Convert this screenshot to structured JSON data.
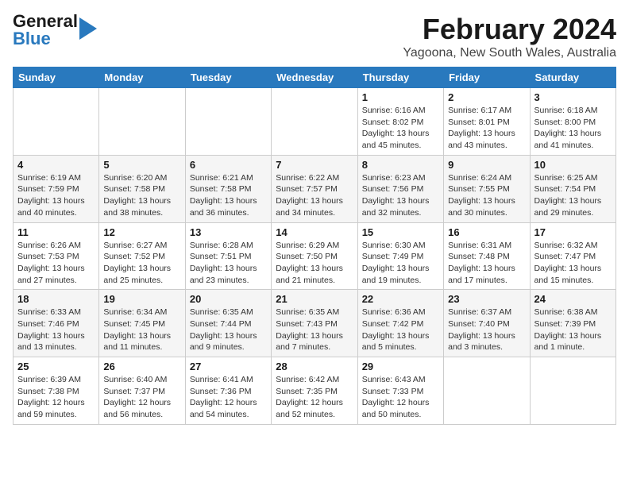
{
  "header": {
    "logo_general": "General",
    "logo_blue": "Blue",
    "month_title": "February 2024",
    "location": "Yagoona, New South Wales, Australia"
  },
  "days_of_week": [
    "Sunday",
    "Monday",
    "Tuesday",
    "Wednesday",
    "Thursday",
    "Friday",
    "Saturday"
  ],
  "weeks": [
    [
      {
        "day": "",
        "info": ""
      },
      {
        "day": "",
        "info": ""
      },
      {
        "day": "",
        "info": ""
      },
      {
        "day": "",
        "info": ""
      },
      {
        "day": "1",
        "info": "Sunrise: 6:16 AM\nSunset: 8:02 PM\nDaylight: 13 hours\nand 45 minutes."
      },
      {
        "day": "2",
        "info": "Sunrise: 6:17 AM\nSunset: 8:01 PM\nDaylight: 13 hours\nand 43 minutes."
      },
      {
        "day": "3",
        "info": "Sunrise: 6:18 AM\nSunset: 8:00 PM\nDaylight: 13 hours\nand 41 minutes."
      }
    ],
    [
      {
        "day": "4",
        "info": "Sunrise: 6:19 AM\nSunset: 7:59 PM\nDaylight: 13 hours\nand 40 minutes."
      },
      {
        "day": "5",
        "info": "Sunrise: 6:20 AM\nSunset: 7:58 PM\nDaylight: 13 hours\nand 38 minutes."
      },
      {
        "day": "6",
        "info": "Sunrise: 6:21 AM\nSunset: 7:58 PM\nDaylight: 13 hours\nand 36 minutes."
      },
      {
        "day": "7",
        "info": "Sunrise: 6:22 AM\nSunset: 7:57 PM\nDaylight: 13 hours\nand 34 minutes."
      },
      {
        "day": "8",
        "info": "Sunrise: 6:23 AM\nSunset: 7:56 PM\nDaylight: 13 hours\nand 32 minutes."
      },
      {
        "day": "9",
        "info": "Sunrise: 6:24 AM\nSunset: 7:55 PM\nDaylight: 13 hours\nand 30 minutes."
      },
      {
        "day": "10",
        "info": "Sunrise: 6:25 AM\nSunset: 7:54 PM\nDaylight: 13 hours\nand 29 minutes."
      }
    ],
    [
      {
        "day": "11",
        "info": "Sunrise: 6:26 AM\nSunset: 7:53 PM\nDaylight: 13 hours\nand 27 minutes."
      },
      {
        "day": "12",
        "info": "Sunrise: 6:27 AM\nSunset: 7:52 PM\nDaylight: 13 hours\nand 25 minutes."
      },
      {
        "day": "13",
        "info": "Sunrise: 6:28 AM\nSunset: 7:51 PM\nDaylight: 13 hours\nand 23 minutes."
      },
      {
        "day": "14",
        "info": "Sunrise: 6:29 AM\nSunset: 7:50 PM\nDaylight: 13 hours\nand 21 minutes."
      },
      {
        "day": "15",
        "info": "Sunrise: 6:30 AM\nSunset: 7:49 PM\nDaylight: 13 hours\nand 19 minutes."
      },
      {
        "day": "16",
        "info": "Sunrise: 6:31 AM\nSunset: 7:48 PM\nDaylight: 13 hours\nand 17 minutes."
      },
      {
        "day": "17",
        "info": "Sunrise: 6:32 AM\nSunset: 7:47 PM\nDaylight: 13 hours\nand 15 minutes."
      }
    ],
    [
      {
        "day": "18",
        "info": "Sunrise: 6:33 AM\nSunset: 7:46 PM\nDaylight: 13 hours\nand 13 minutes."
      },
      {
        "day": "19",
        "info": "Sunrise: 6:34 AM\nSunset: 7:45 PM\nDaylight: 13 hours\nand 11 minutes."
      },
      {
        "day": "20",
        "info": "Sunrise: 6:35 AM\nSunset: 7:44 PM\nDaylight: 13 hours\nand 9 minutes."
      },
      {
        "day": "21",
        "info": "Sunrise: 6:35 AM\nSunset: 7:43 PM\nDaylight: 13 hours\nand 7 minutes."
      },
      {
        "day": "22",
        "info": "Sunrise: 6:36 AM\nSunset: 7:42 PM\nDaylight: 13 hours\nand 5 minutes."
      },
      {
        "day": "23",
        "info": "Sunrise: 6:37 AM\nSunset: 7:40 PM\nDaylight: 13 hours\nand 3 minutes."
      },
      {
        "day": "24",
        "info": "Sunrise: 6:38 AM\nSunset: 7:39 PM\nDaylight: 13 hours\nand 1 minute."
      }
    ],
    [
      {
        "day": "25",
        "info": "Sunrise: 6:39 AM\nSunset: 7:38 PM\nDaylight: 12 hours\nand 59 minutes."
      },
      {
        "day": "26",
        "info": "Sunrise: 6:40 AM\nSunset: 7:37 PM\nDaylight: 12 hours\nand 56 minutes."
      },
      {
        "day": "27",
        "info": "Sunrise: 6:41 AM\nSunset: 7:36 PM\nDaylight: 12 hours\nand 54 minutes."
      },
      {
        "day": "28",
        "info": "Sunrise: 6:42 AM\nSunset: 7:35 PM\nDaylight: 12 hours\nand 52 minutes."
      },
      {
        "day": "29",
        "info": "Sunrise: 6:43 AM\nSunset: 7:33 PM\nDaylight: 12 hours\nand 50 minutes."
      },
      {
        "day": "",
        "info": ""
      },
      {
        "day": "",
        "info": ""
      }
    ]
  ]
}
